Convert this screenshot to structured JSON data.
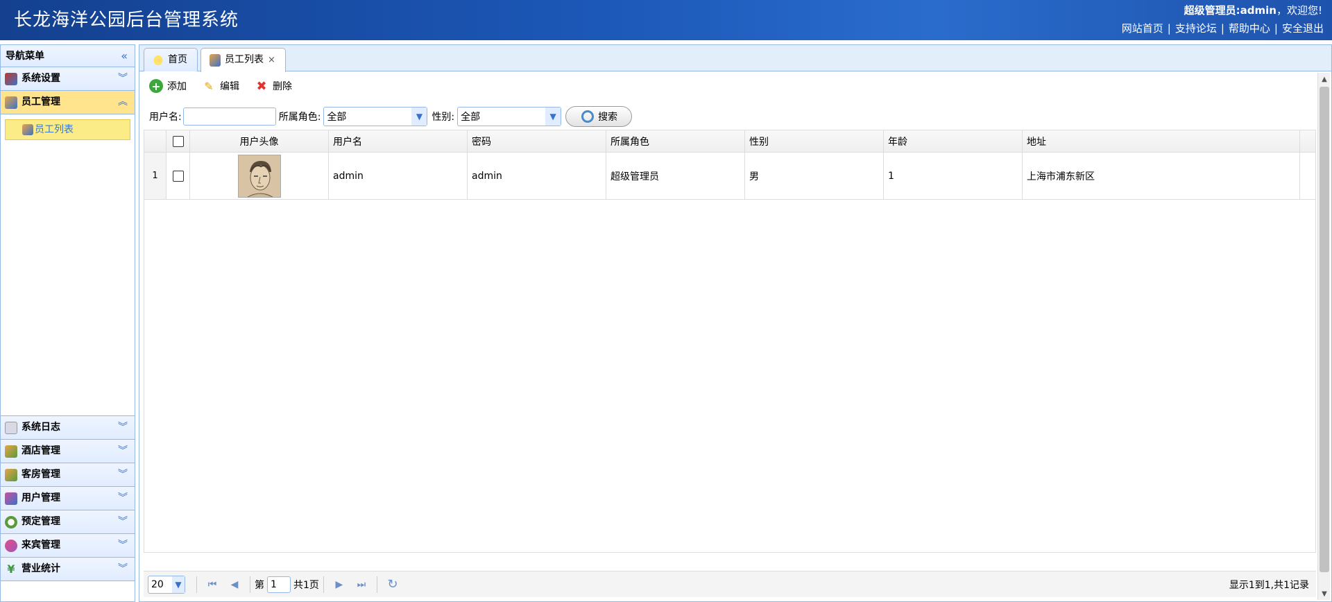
{
  "header": {
    "title": "长龙海洋公园后台管理系统",
    "welcome_prefix": "超级管理员:",
    "username": "admin",
    "welcome_suffix": "，欢迎您!",
    "links": [
      "网站首页",
      "支持论坛",
      "帮助中心",
      "安全退出"
    ]
  },
  "nav": {
    "title": "导航菜单",
    "sections": [
      {
        "label": "系统设置",
        "icon": "tools-icon"
      },
      {
        "label": "员工管理",
        "icon": "staff-icon",
        "active": true
      }
    ],
    "sub_items": [
      {
        "label": "员工列表",
        "icon": "staff-list-icon"
      }
    ],
    "bottom_sections": [
      {
        "label": "系统日志",
        "icon": "log-icon"
      },
      {
        "label": "酒店管理",
        "icon": "hotel-icon"
      },
      {
        "label": "客房管理",
        "icon": "room-icon"
      },
      {
        "label": "用户管理",
        "icon": "users-icon"
      },
      {
        "label": "预定管理",
        "icon": "booking-icon"
      },
      {
        "label": "来宾管理",
        "icon": "guest-icon"
      },
      {
        "label": "营业统计",
        "icon": "yen-icon"
      }
    ]
  },
  "tabs": [
    {
      "label": "首页",
      "icon": "lightbulb-icon"
    },
    {
      "label": "员工列表",
      "icon": "staff-list-icon",
      "close": "×",
      "active": true
    }
  ],
  "toolbar": {
    "add": "添加",
    "edit": "编辑",
    "delete": "删除"
  },
  "search": {
    "username_label": "用户名:",
    "username_value": "",
    "role_label": "所属角色:",
    "role_value": "全部",
    "gender_label": "性别:",
    "gender_value": "全部",
    "search_button": "搜索"
  },
  "table": {
    "columns": [
      "用户头像",
      "用户名",
      "密码",
      "所属角色",
      "性别",
      "年龄",
      "地址"
    ],
    "rows": [
      {
        "no": "1",
        "username": "admin",
        "password": "admin",
        "role": "超级管理员",
        "gender": "男",
        "age": "1",
        "address": "上海市浦东新区"
      }
    ]
  },
  "pager": {
    "page_size": "20",
    "page_prefix": "第",
    "page_value": "1",
    "page_total": "共1页",
    "summary": "显示1到1,共1记录"
  },
  "colors": {
    "accent": "#95b8e7",
    "header_bg": "#1c58b8",
    "active_item": "#ffe48d",
    "link": "#3777c9"
  }
}
